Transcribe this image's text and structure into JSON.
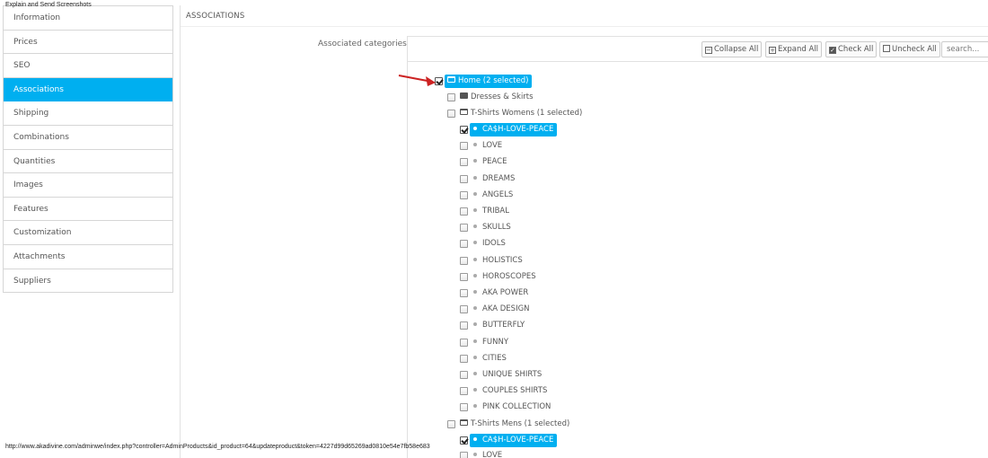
{
  "overlay_title": "Explain and Send Screenshots",
  "status_url": "http://www.akadivine.com/adminwe/index.php?controller=AdminProducts&id_product=64&updateproduct&token=4227d99d65269ad0810e54e7fb58e683",
  "sidebar": {
    "items": [
      {
        "label": "Information"
      },
      {
        "label": "Prices"
      },
      {
        "label": "SEO"
      },
      {
        "label": "Associations",
        "active": true
      },
      {
        "label": "Shipping"
      },
      {
        "label": "Combinations"
      },
      {
        "label": "Quantities"
      },
      {
        "label": "Images"
      },
      {
        "label": "Features"
      },
      {
        "label": "Customization"
      },
      {
        "label": "Attachments"
      },
      {
        "label": "Suppliers"
      }
    ]
  },
  "panel": {
    "heading": "ASSOCIATIONS",
    "associated_label": "Associated categories"
  },
  "toolbar": {
    "collapse_all": "Collapse All",
    "expand_all": "Expand All",
    "check_all": "Check All",
    "uncheck_all": "Uncheck All",
    "search_placeholder": "search..."
  },
  "tree": {
    "home": "Home (2 selected)",
    "dresses": "Dresses & Skirts",
    "tshirts_women": "T-Shirts Womens (1 selected)",
    "women_children": [
      "CA$H-LOVE-PEACE",
      "LOVE",
      "PEACE",
      "DREAMS",
      "ANGELS",
      "TRIBAL",
      "SKULLS",
      "IDOLS",
      "HOLISTICS",
      "HOROSCOPES",
      "AKA POWER",
      "AKA DESIGN",
      "BUTTERFLY",
      "FUNNY",
      "CITIES",
      "UNIQUE SHIRTS",
      "COUPLES SHIRTS",
      "PINK COLLECTION"
    ],
    "tshirts_men": "T-Shirts Mens (1 selected)",
    "men_children": [
      "CA$H-LOVE-PEACE",
      "LOVE"
    ]
  },
  "colors": {
    "accent": "#00aff0",
    "arrow": "#cc2222"
  }
}
